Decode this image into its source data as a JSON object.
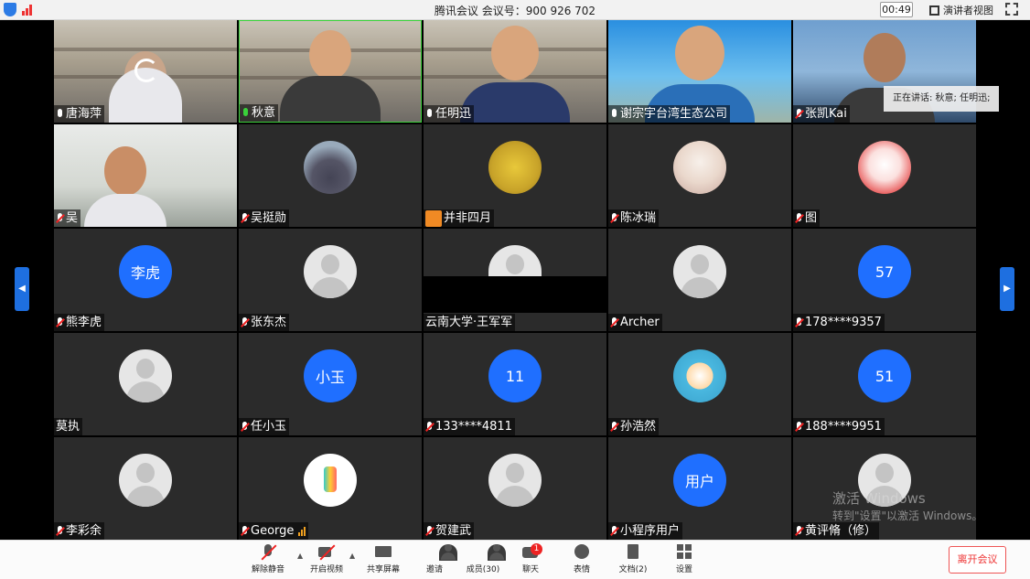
{
  "titlebar": {
    "title": "腾讯会议 会议号：900 926 702",
    "timer": "00:49",
    "view_label": "演讲者视图"
  },
  "tiles": [
    {
      "name": "唐海萍"
    },
    {
      "name": "秋意"
    },
    {
      "name": "任明迅"
    },
    {
      "name": "谢宗宇台湾生态公司"
    },
    {
      "name": "张凯Kai"
    },
    {
      "name": "吴"
    },
    {
      "name": "吴挺勋"
    },
    {
      "name": "并非四月"
    },
    {
      "name": "陈冰瑞"
    },
    {
      "name": "图"
    },
    {
      "name": "熊李虎",
      "avatar_text": "李虎"
    },
    {
      "name": "张东杰"
    },
    {
      "name": "云南大学·王军军"
    },
    {
      "name": "Archer"
    },
    {
      "name": "178****9357",
      "avatar_text": "57"
    },
    {
      "name": "莫执"
    },
    {
      "name": "任小玉",
      "avatar_text": "小玉"
    },
    {
      "name": "133****4811",
      "avatar_text": "11"
    },
    {
      "name": "孙浩然"
    },
    {
      "name": "188****9951",
      "avatar_text": "51"
    },
    {
      "name": "李彩余"
    },
    {
      "name": "George"
    },
    {
      "name": "贺建武"
    },
    {
      "name": "小程序用户",
      "avatar_text": "用户"
    },
    {
      "name": "黄评脩（修）"
    }
  ],
  "speaking": "正在讲话: 秋意; 任明迅;",
  "watermark": {
    "line1": "激活 Windows",
    "line2": "转到\"设置\"以激活 Windows。"
  },
  "toolbar": {
    "unmute": "解除静音",
    "start_video": "开启视频",
    "share": "共享屏幕",
    "invite": "邀请",
    "members": "成员(30)",
    "chat": "聊天",
    "chat_badge": "1",
    "reactions": "表情",
    "docs": "文档(2)",
    "settings": "设置",
    "leave": "离开会议"
  },
  "colors": {
    "accent": "#1f6fff",
    "danger": "#e22222",
    "tile_bg": "#2b2b2b"
  }
}
